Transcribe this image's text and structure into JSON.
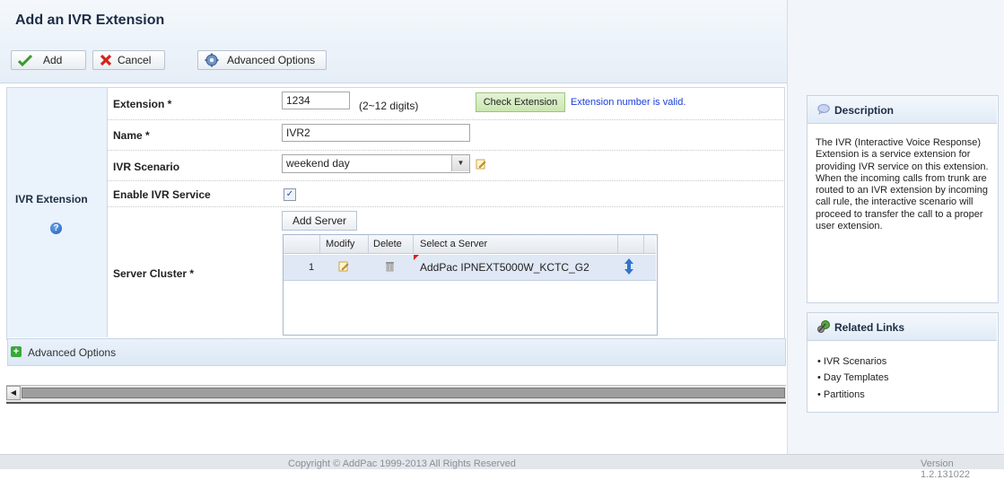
{
  "header": {
    "title": "Add an IVR Extension",
    "add_label": "Add",
    "cancel_label": "Cancel",
    "advanced_label": "Advanced Options"
  },
  "section": {
    "label": "IVR Extension",
    "help_glyph": "?"
  },
  "form": {
    "extension_label": "Extension *",
    "extension_value": "1234",
    "extension_hint": "(2~12 digits)",
    "check_button": "Check Extension",
    "check_result": "Extension number is valid.",
    "name_label": "Name *",
    "name_value": "IVR2",
    "scenario_label": "IVR Scenario",
    "scenario_value": "weekend day",
    "enable_label": "Enable IVR Service",
    "enable_checked": true,
    "cluster_label": "Server Cluster *",
    "add_server_label": "Add Server"
  },
  "server_grid": {
    "columns": [
      "Modify",
      "Delete",
      "Select a Server"
    ],
    "rows": [
      {
        "num": "1",
        "server": "AddPac IPNEXT5000W_KCTC_G2"
      }
    ]
  },
  "advanced_bar": {
    "label": "Advanced Options"
  },
  "description": {
    "title": "Description",
    "text": "The IVR (Interactive Voice Response) Extension is a service extension for providing IVR service on this extension. When the incoming calls from trunk are routed to an IVR extension by incoming call rule, the interactive scenario will proceed to transfer the call to a proper user extension."
  },
  "related": {
    "title": "Related Links",
    "items": [
      "• IVR Scenarios",
      "• Day Templates",
      "• Partitions"
    ]
  },
  "footer": {
    "copyright": "Copyright © AddPac 1999-2013 All Rights Reserved",
    "version": "Version 1.2.131022"
  },
  "colors": {
    "valid_text": "#1a3ed8",
    "panel_bg": "#eaf2fb",
    "check_btn": "#c9e7ae"
  },
  "icons": [
    "check-icon",
    "cross-icon",
    "gear-icon",
    "help-icon",
    "pencil-icon",
    "trash-icon",
    "updown-icon",
    "plus-icon",
    "speech-icon",
    "links-icon"
  ]
}
